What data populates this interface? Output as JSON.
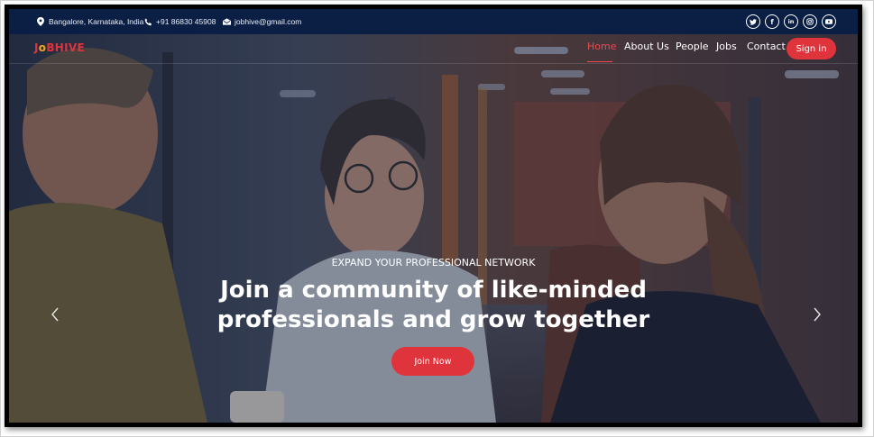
{
  "topbar": {
    "location": "Bangalore, Karnataka, India",
    "phone": "+91 86830 45908",
    "email": "jobhive@gmail.com",
    "social_icons": [
      "twitter-icon",
      "facebook-icon",
      "linkedin-icon",
      "instagram-icon",
      "youtube-icon"
    ]
  },
  "brand": {
    "logo_prefix": "J",
    "logo_o": "o",
    "logo_suffix": "BHIVE"
  },
  "nav": {
    "items": [
      {
        "label": "Home",
        "active": true
      },
      {
        "label": "About Us",
        "active": false
      },
      {
        "label": "People",
        "active": false
      },
      {
        "label": "Jobs",
        "active": false
      },
      {
        "label": "Contact",
        "active": false
      }
    ],
    "signin_label": "Sign in"
  },
  "hero": {
    "eyebrow": "EXPAND YOUR PROFESSIONAL NETWORK",
    "headline_line1": "Join a community of like-minded",
    "headline_line2": "professionals and grow together",
    "cta_label": "Join Now"
  },
  "carousel": {
    "prev_icon": "chevron-left-icon",
    "next_icon": "chevron-right-icon"
  },
  "colors": {
    "topbar_bg": "#0b1f44",
    "accent": "#e0343c",
    "logo_o": "#f1a81e"
  }
}
